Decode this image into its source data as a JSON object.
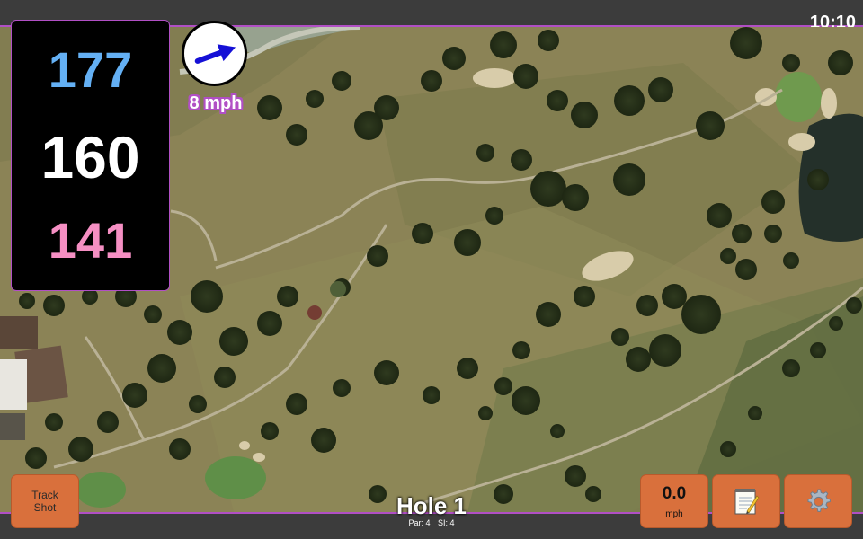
{
  "status": {
    "time": "10:10"
  },
  "distances": {
    "back": "177",
    "middle": "160",
    "front": "141"
  },
  "wind": {
    "speed_text": "8 mph",
    "direction_icon": "arrow-east-northeast-icon"
  },
  "hole": {
    "title": "Hole 1",
    "par": "Par: 4",
    "si": "SI: 4"
  },
  "buttons": {
    "track_shot_line1": "Track",
    "track_shot_line2": "Shot",
    "shot_speed_value": "0.0",
    "shot_speed_unit": "mph",
    "notes_icon": "notepad-icon",
    "settings_icon": "gear-icon"
  },
  "colors": {
    "back_distance": "#64b0f4",
    "middle_distance": "#ffffff",
    "front_distance": "#f58fc3",
    "accent_border": "#b14fc5",
    "button_orange": "#d9703c"
  }
}
